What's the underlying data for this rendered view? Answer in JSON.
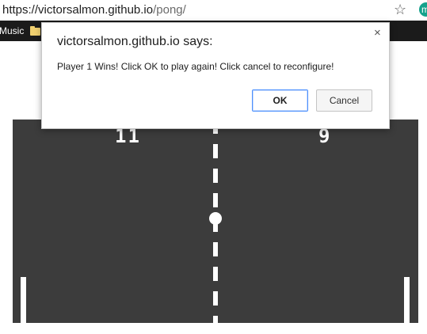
{
  "browser": {
    "url_host": "https://victorsalmon.github.io",
    "url_path": "/pong/",
    "star_icon": "star-outline",
    "extension_letter": "m"
  },
  "bookmarks": {
    "items": [
      {
        "label": "Music"
      },
      {
        "label": "",
        "icon": "folder-icon"
      }
    ]
  },
  "game": {
    "score_left": "11",
    "score_right": "9",
    "background_color": "#3c3c3c"
  },
  "dialog": {
    "title": "victorsalmon.github.io says:",
    "close_label": "×",
    "message": "Player 1 Wins! Click OK to play again! Click cancel to reconfigure!",
    "ok_label": "OK",
    "cancel_label": "Cancel",
    "accent_color": "#4d90fe"
  }
}
